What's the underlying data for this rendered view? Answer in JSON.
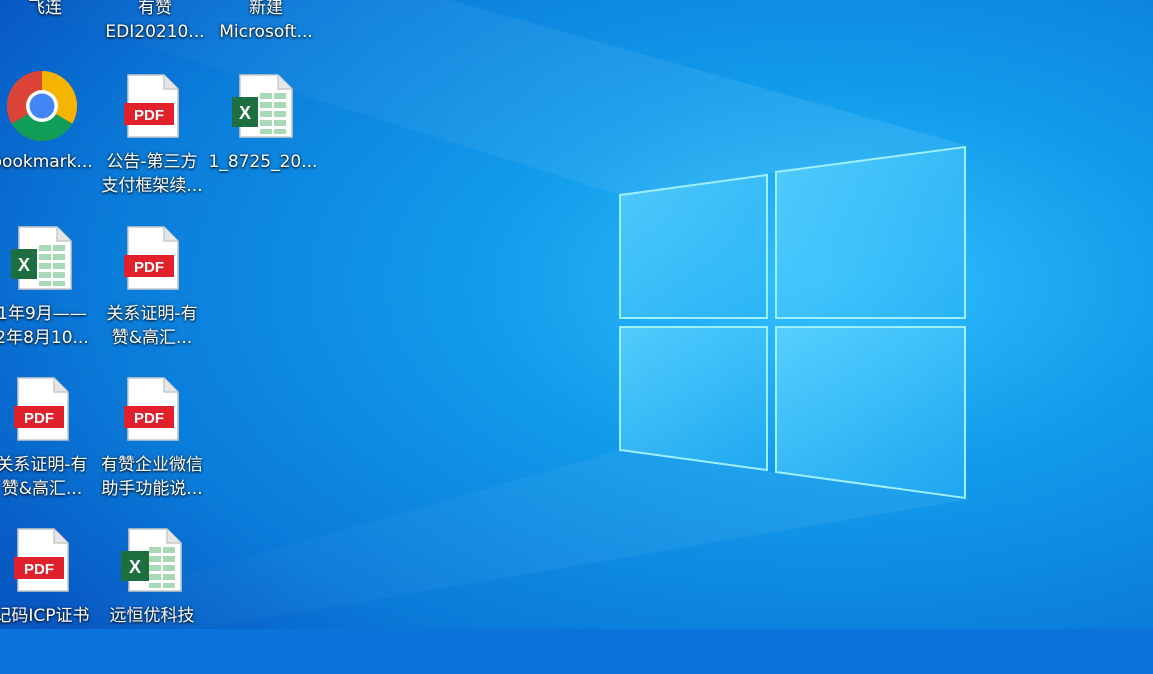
{
  "desktop": {
    "partial_top": [
      {
        "line1": "飞连",
        "line2": ""
      },
      {
        "line1": "有赞",
        "line2": "EDI20210..."
      },
      {
        "line1": "新建",
        "line2": "Microsoft..."
      }
    ],
    "icons": [
      {
        "type": "chrome-icon",
        "line1": "bookmark...",
        "line2": ""
      },
      {
        "type": "pdf-icon",
        "badge": "PDF",
        "line1": "公告-第三方",
        "line2": "支付框架续..."
      },
      {
        "type": "excel-icon",
        "badge": "X",
        "line1": "1_8725_20...",
        "line2": ""
      },
      {
        "type": "excel-icon",
        "badge": "X",
        "line1": "1年9月——",
        "line2": "2年8月10..."
      },
      {
        "type": "pdf-icon",
        "badge": "PDF",
        "line1": "关系证明-有",
        "line2": "赞&高汇..."
      },
      {
        "type": "pdf-icon",
        "badge": "PDF",
        "line1": "关系证明-有",
        "line2": "赞&高汇..."
      },
      {
        "type": "pdf-icon",
        "badge": "PDF",
        "line1": "有赞企业微信",
        "line2": "助手功能说..."
      },
      {
        "type": "pdf-icon",
        "badge": "PDF",
        "line1": "记码ICP证书",
        "line2": ""
      },
      {
        "type": "excel-icon",
        "badge": "X",
        "line1": "远恒优科技",
        "line2": ""
      }
    ]
  },
  "colors": {
    "wallpaper_dark": "#0656c4",
    "wallpaper_light": "#1fa3f0",
    "pdf_red": "#e0202b",
    "excel_green": "#1d6f42"
  }
}
